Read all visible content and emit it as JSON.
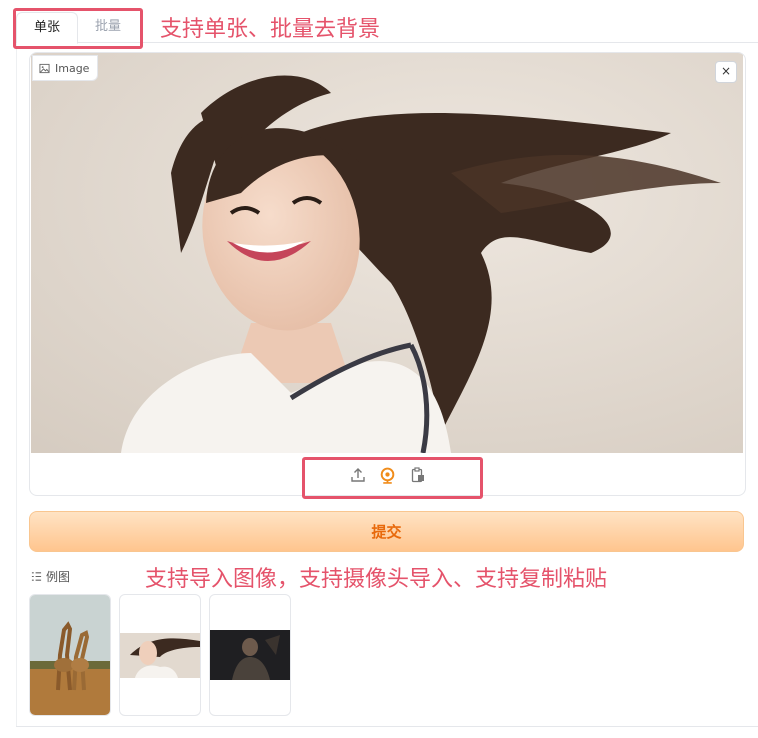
{
  "tabs": [
    {
      "label": "单张",
      "active": true
    },
    {
      "label": "批量",
      "active": false
    }
  ],
  "annotations": {
    "top": "支持单张、批量去背景",
    "middle": "支持导入图像，支持摄像头导入、支持复制粘贴"
  },
  "image_panel": {
    "label": "Image",
    "label_icon": "image-icon",
    "clear_symbol": "×",
    "tools": [
      "upload-icon",
      "webcam-icon",
      "clipboard-icon"
    ]
  },
  "submit_label": "提交",
  "examples": {
    "label": "例图",
    "icon": "list-icon",
    "items": [
      "giraffes-thumbnail",
      "woman-portrait-thumbnail",
      "dark-figure-thumbnail"
    ]
  },
  "colors": {
    "accent": "#e5536b",
    "submit_text": "#e8690b",
    "submit_bg": "#ffd3a6",
    "webcam": "#f08c1a"
  }
}
